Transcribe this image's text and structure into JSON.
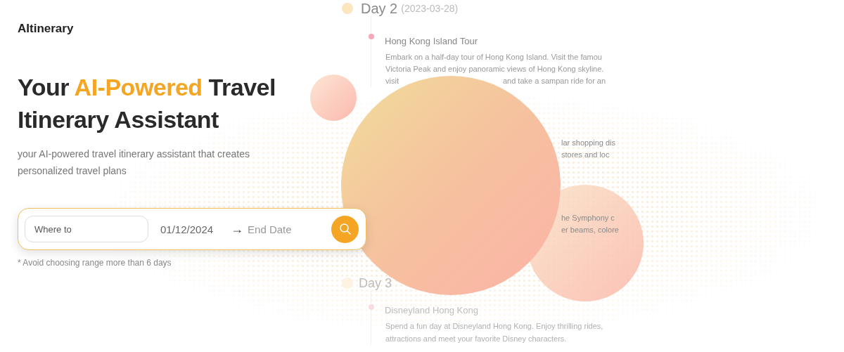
{
  "brand": "AItinerary",
  "headline": [
    {
      "text": "Your ",
      "highlight": false
    },
    {
      "text": "AI-Powered",
      "highlight": true
    },
    {
      "text": " Travel Itinerary Assistant",
      "highlight": false
    }
  ],
  "subtitle": "your AI-powered travel itinerary assistant that creates personalized travel plans",
  "search": {
    "destination": {
      "placeholder": "Where to"
    },
    "start_date": "01/12/2024",
    "arrow": "→",
    "end_date": {
      "placeholder": "End Date"
    }
  },
  "note": "* Avoid choosing range more than 6 days",
  "preview": {
    "days": [
      {
        "title": "Day 2",
        "date": "(2023-03-28)",
        "faded": false,
        "activities": [
          {
            "title": "Hong Kong Island Tour",
            "lines": [
              [
                "Embark on a half-day tour of Hong Kong Island. Visit the famou"
              ],
              [
                "Victoria Peak and enjoy panoramic views of Hong Kong skyline."
              ],
              [
                "visit",
                "and take a sampan ride for an"
              ]
            ]
          }
        ],
        "fragments": [
          {
            "lines": [
              "lar shopping dis",
              "stores and loc"
            ]
          },
          {
            "lines": [
              "he Symphony c",
              "er beams, colore"
            ]
          }
        ]
      },
      {
        "title": "Day 3",
        "faded": true,
        "activities": [
          {
            "title": "Disneyland Hong Kong",
            "lines": [
              [
                "Spend a fun day at Disneyland Hong Kong. Enjoy thrilling rides,"
              ],
              [
                "attractions and meet your favorite Disney characters."
              ]
            ]
          }
        ]
      }
    ]
  }
}
